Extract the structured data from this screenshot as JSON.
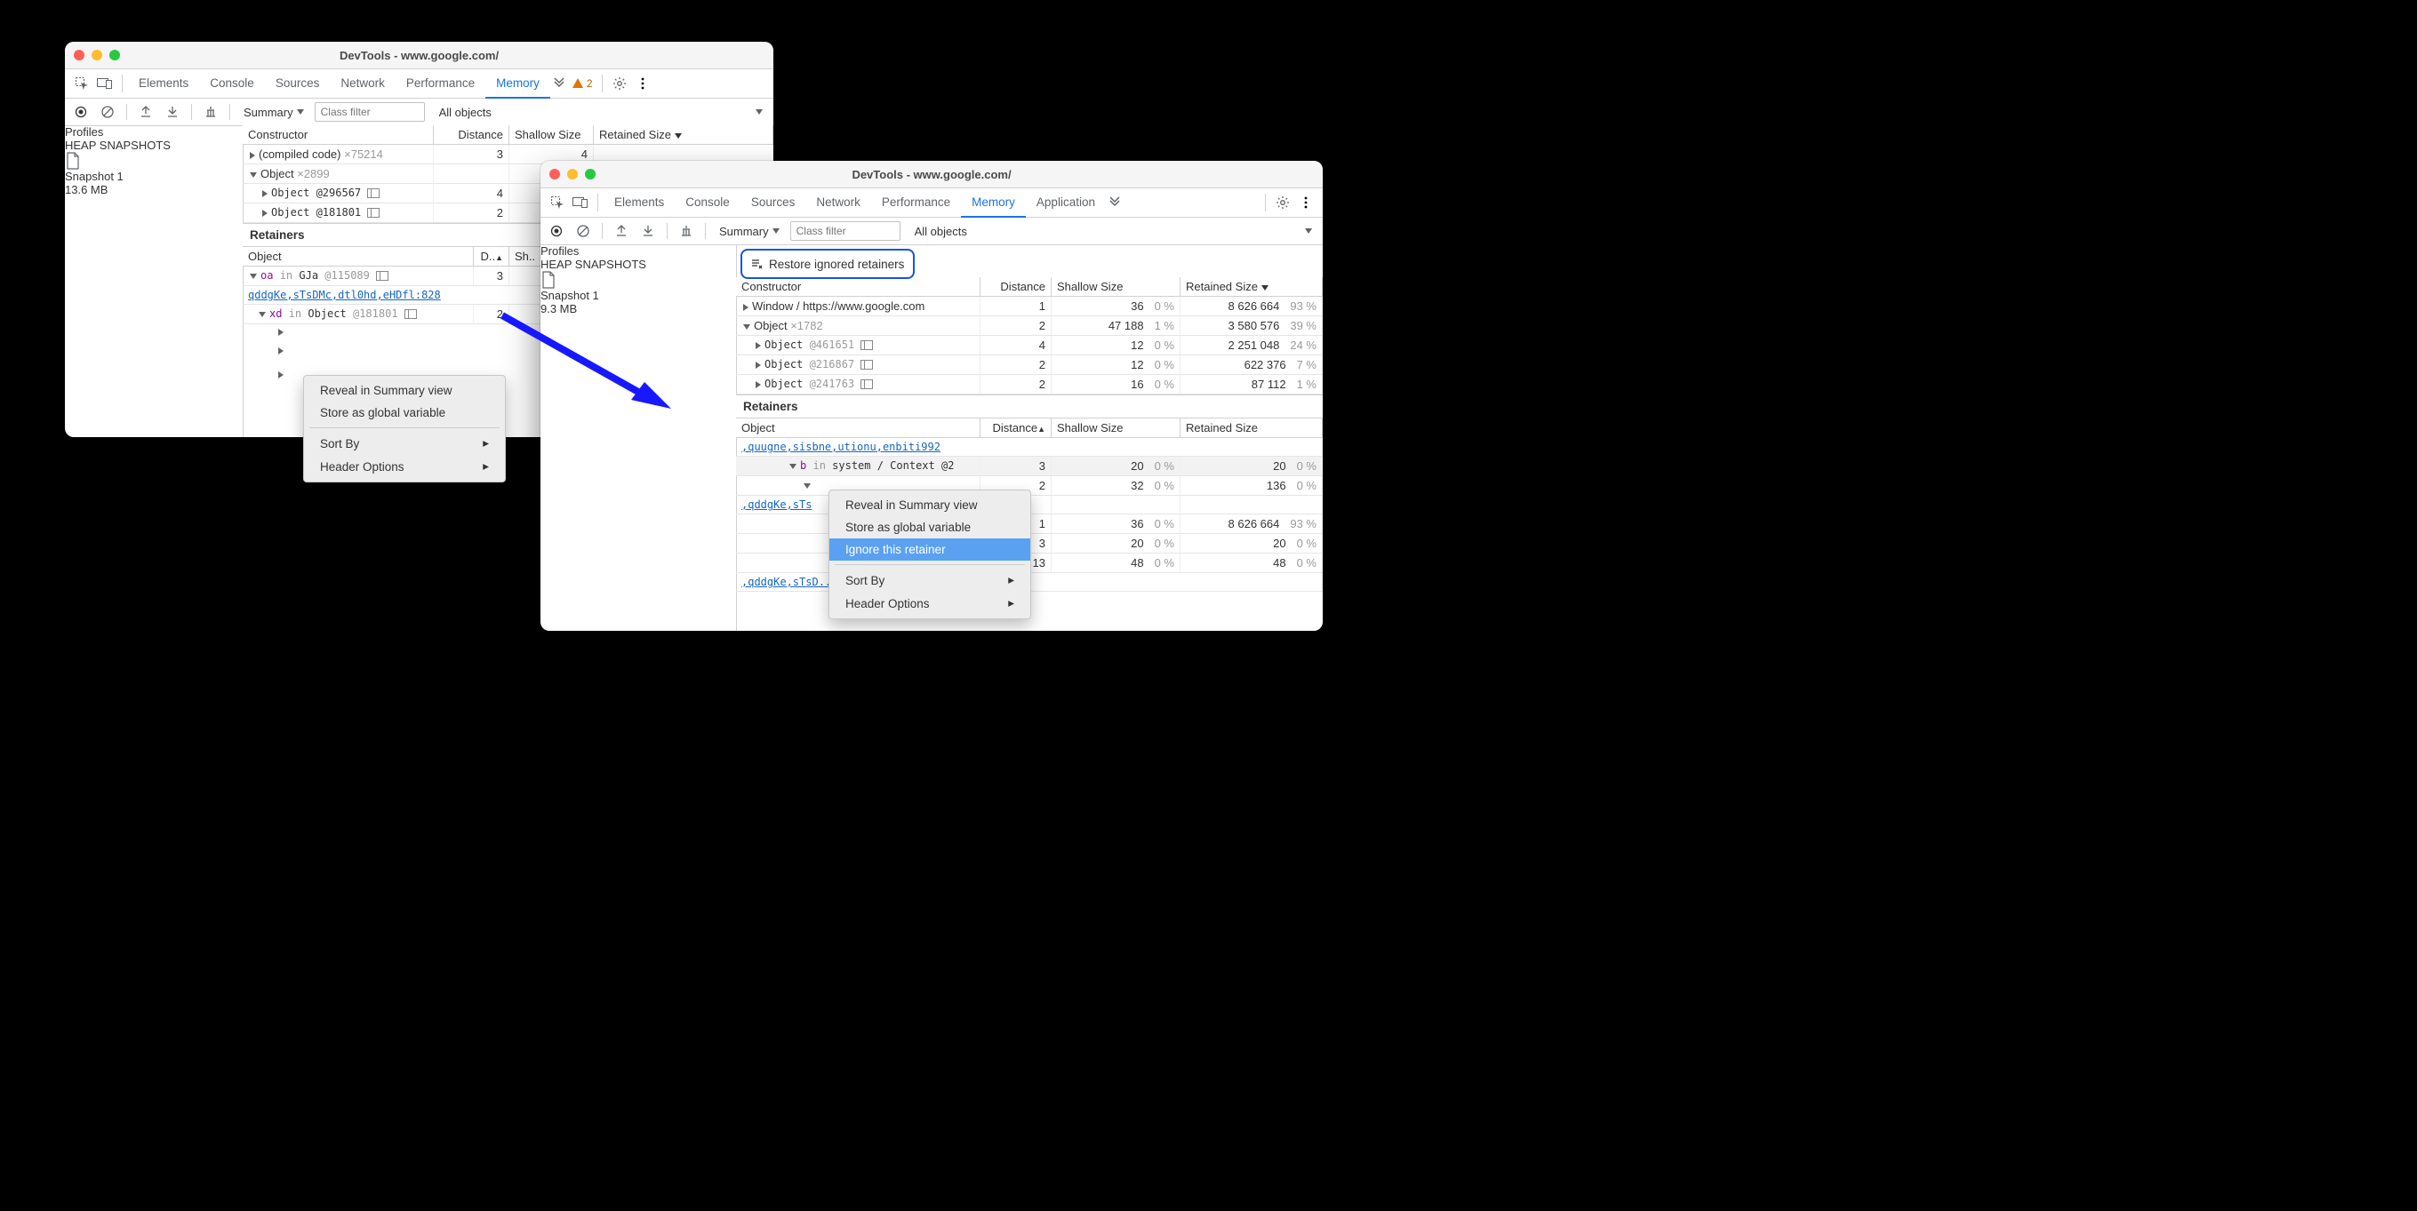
{
  "window_title": "DevTools - www.google.com/",
  "tabs": {
    "elements": "Elements",
    "console": "Console",
    "sources": "Sources",
    "network": "Network",
    "performance": "Performance",
    "memory": "Memory",
    "application": "Application"
  },
  "warning_count": "2",
  "toolbar": {
    "view": "Summary",
    "filter_placeholder": "Class filter",
    "scope": "All objects"
  },
  "sidebar": {
    "profiles": "Profiles",
    "heap_snapshots": "HEAP SNAPSHOTS"
  },
  "table_headers": {
    "constructor": "Constructor",
    "object": "Object",
    "distance": "Distance",
    "distance_abbr": "D..",
    "shallow": "Shallow Size",
    "shallow_abbr": "Sh..",
    "retained": "Retained Size"
  },
  "retainers_label": "Retainers",
  "restore_label": "Restore ignored retainers",
  "left": {
    "snapshot": {
      "name": "Snapshot 1",
      "size": "13.6 MB"
    },
    "rows": [
      {
        "name": "(compiled code)",
        "mult": "×75214",
        "distance": "3",
        "shallow": "4"
      },
      {
        "name": "Object",
        "mult": "×2899",
        "distance": "",
        "shallow": ""
      },
      {
        "name": "Object @296567",
        "distance": "4",
        "icon": true
      },
      {
        "name": "Object @181801",
        "distance": "2",
        "icon": true
      }
    ],
    "retainers": {
      "row1_pre": "oa",
      "row1_in": "in",
      "row1_obj": "GJa",
      "row1_id": "@115089",
      "row1_d": "3",
      "row2": "qddgKe,sTsDMc,dtl0hd,eHDfl:828",
      "row3_pre": "xd",
      "row3_in": "in",
      "row3_obj": "Object",
      "row3_id": "@181801",
      "row3_d": "2"
    },
    "menu": {
      "reveal": "Reveal in Summary view",
      "store": "Store as global variable",
      "sort": "Sort By",
      "header": "Header Options"
    }
  },
  "right": {
    "snapshot": {
      "name": "Snapshot 1",
      "size": "9.3 MB"
    },
    "rows": [
      {
        "name": "Window / https://www.google.com",
        "distance": "1",
        "shallow": "36",
        "sp": "0 %",
        "retained": "8 626 664",
        "rp": "93 %"
      },
      {
        "name": "Object",
        "mult": "×1782",
        "distance": "2",
        "shallow": "47 188",
        "sp": "1 %",
        "retained": "3 580 576",
        "rp": "39 %"
      },
      {
        "name": "Object @461651",
        "distance": "4",
        "shallow": "12",
        "sp": "0 %",
        "retained": "2 251 048",
        "rp": "24 %",
        "icon": true
      },
      {
        "name": "Object @216867",
        "distance": "2",
        "shallow": "12",
        "sp": "0 %",
        "retained": "622 376",
        "rp": "7 %",
        "icon": true
      },
      {
        "name": "Object @241763",
        "distance": "2",
        "shallow": "16",
        "sp": "0 %",
        "retained": "87 112",
        "rp": "1 %",
        "icon": true
      }
    ],
    "retainers": {
      "cut1": ",quugne,sisbne,utionu,enbiti992",
      "row1_pre": "b",
      "row1_in": "in",
      "row1_obj": "system / Context @2",
      "row1_d": "3",
      "row1_s": "20",
      "row1_sp": "0 %",
      "row1_r": "20",
      "row1_rp": "0 %",
      "row2_d": "2",
      "row2_s": "32",
      "row2_sp": "0 %",
      "row2_r": "136",
      "row2_rp": "0 %",
      "cut2": ",qddgKe,sTs",
      "row3_d": "1",
      "row3_s": "36",
      "row3_sp": "0 %",
      "row3_r": "8 626 664",
      "row3_rp": "93 %",
      "row4_d": "3",
      "row4_s": "20",
      "row4_sp": "0 %",
      "row4_r": "20",
      "row4_rp": "0 %",
      "row5_d": "13",
      "row5_s": "48",
      "row5_sp": "0 %",
      "row5_r": "48",
      "row5_rp": "0 %",
      "cut3": ",qddgKe,sTsD..e,sisbne,utionu,enbil.425"
    },
    "menu": {
      "reveal": "Reveal in Summary view",
      "store": "Store as global variable",
      "ignore": "Ignore this retainer",
      "sort": "Sort By",
      "header": "Header Options"
    }
  }
}
